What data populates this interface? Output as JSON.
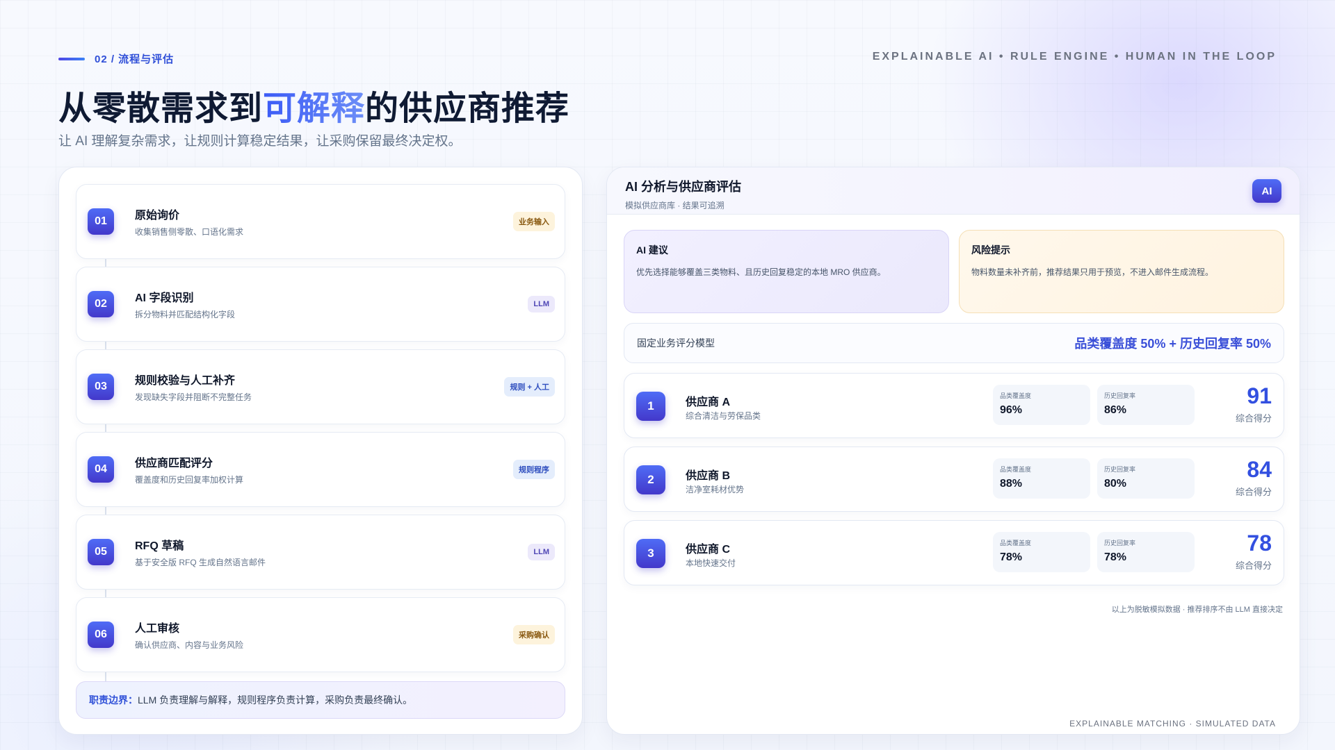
{
  "header": {
    "section": "02 / 流程与评估",
    "tagline": "EXPLAINABLE AI • RULE ENGINE • HUMAN IN THE LOOP",
    "title_pre": "从零散需求到",
    "title_highlight": "可解释",
    "title_post": "的供应商推荐",
    "subtitle": "让 AI 理解复杂需求，让规则计算稳定结果，让采购保留最终决定权。"
  },
  "steps": [
    {
      "num": "01",
      "title": "原始询价",
      "desc": "收集销售侧零散、口语化需求",
      "badge": "业务输入"
    },
    {
      "num": "02",
      "title": "AI 字段识别",
      "desc": "拆分物料并匹配结构化字段",
      "badge": "LLM"
    },
    {
      "num": "03",
      "title": "规则校验与人工补齐",
      "desc": "发现缺失字段并阻断不完整任务",
      "badge": "规则 + 人工"
    },
    {
      "num": "04",
      "title": "供应商匹配评分",
      "desc": "覆盖度和历史回复率加权计算",
      "badge": "规则程序"
    },
    {
      "num": "05",
      "title": "RFQ 草稿",
      "desc": "基于安全版 RFQ 生成自然语言邮件",
      "badge": "LLM"
    },
    {
      "num": "06",
      "title": "人工审核",
      "desc": "确认供应商、内容与业务风险",
      "badge": "采购确认"
    }
  ],
  "duty": {
    "label": "职责边界：",
    "text": "LLM 负责理解与解释，规则程序负责计算，采购负责最终确认。"
  },
  "panel": {
    "title": "AI 分析与供应商评估",
    "subtitle": "模拟供应商库 · 结果可追溯",
    "chip": "AI",
    "ai_card": {
      "title": "AI 建议",
      "text": "优先选择能够覆盖三类物料、且历史回复稳定的本地 MRO 供应商。"
    },
    "risk_card": {
      "title": "风险提示",
      "text": "物料数量未补齐前，推荐结果只用于预览，不进入邮件生成流程。"
    },
    "model_label": "固定业务评分模型",
    "model_formula": "品类覆盖度 50% + 历史回复率 50%",
    "score_label": "综合得分",
    "metric1_label": "品类覆盖度",
    "metric2_label": "历史回复率",
    "suppliers": [
      {
        "rank": "1",
        "name": "供应商 A",
        "desc": "综合清洁与劳保品类",
        "coverage": "96%",
        "reply": "86%",
        "score": "91"
      },
      {
        "rank": "2",
        "name": "供应商 B",
        "desc": "洁净室耗材优势",
        "coverage": "88%",
        "reply": "80%",
        "score": "84"
      },
      {
        "rank": "3",
        "name": "供应商 C",
        "desc": "本地快速交付",
        "coverage": "78%",
        "reply": "78%",
        "score": "78"
      }
    ],
    "data_note": "以上为脱敏模拟数据 · 推荐排序不由 LLM 直接决定",
    "footer": "EXPLAINABLE MATCHING · SIMULATED DATA"
  },
  "colors": {
    "accent": "#3b5bf6",
    "accent_dark": "#4338ca",
    "amber": "#fdf3dc",
    "ink": "#0f172a"
  }
}
